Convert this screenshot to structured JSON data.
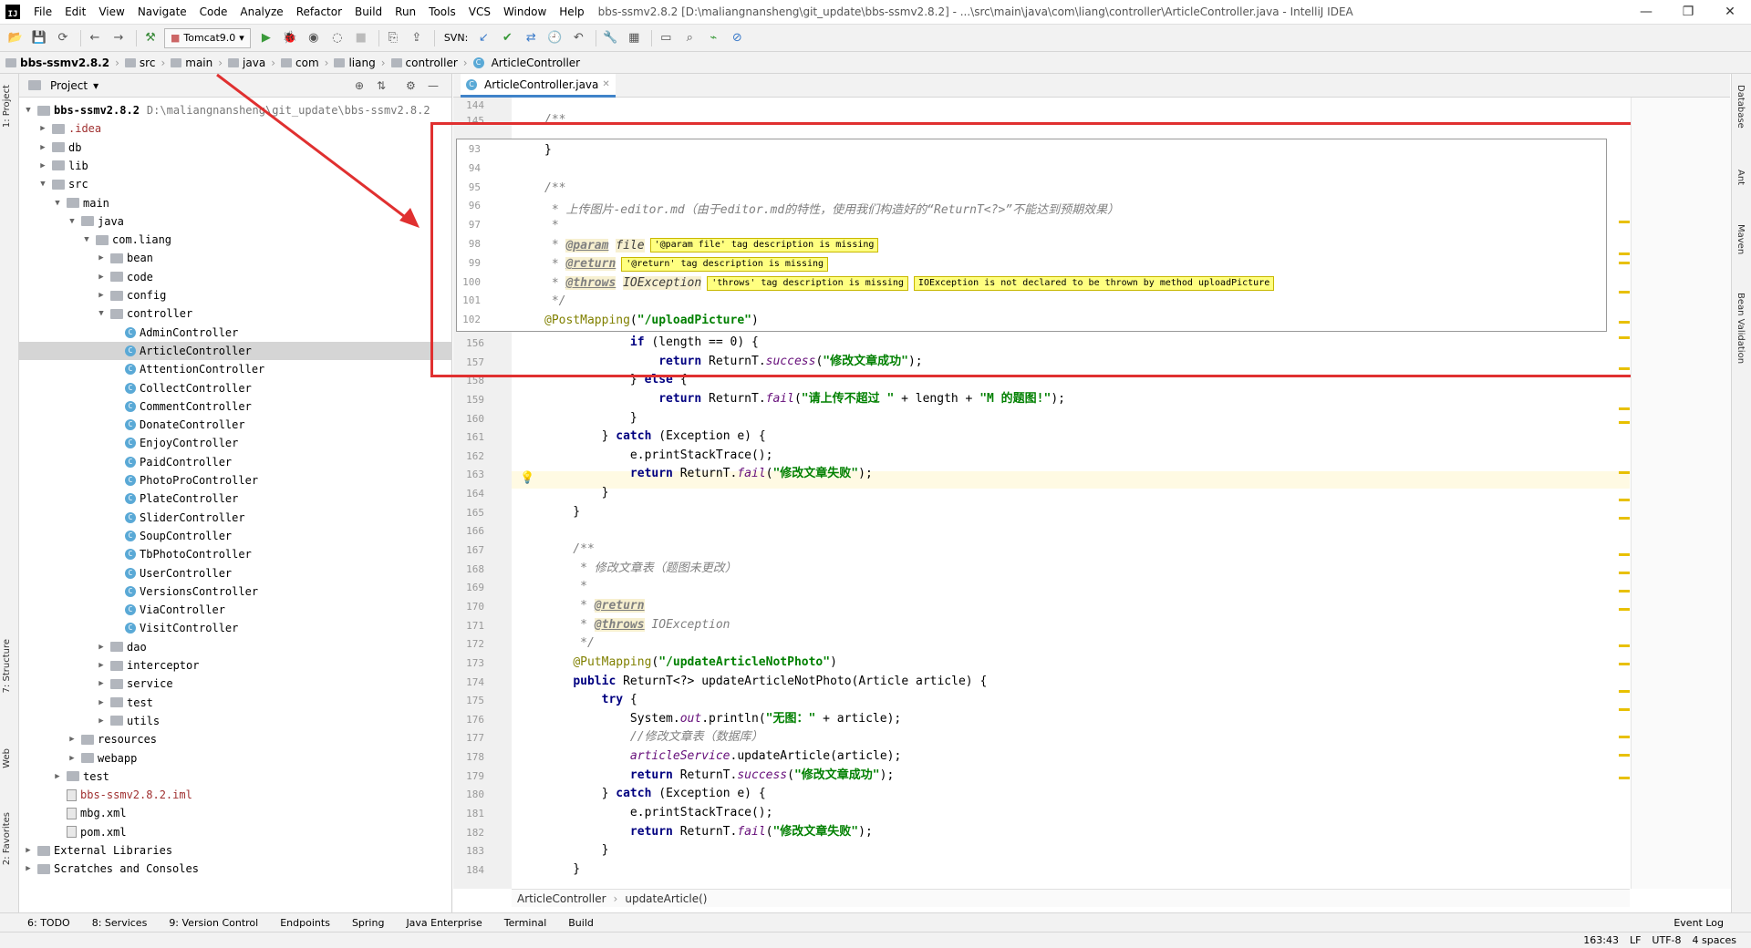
{
  "title_bar": {
    "menus": [
      "File",
      "Edit",
      "View",
      "Navigate",
      "Code",
      "Analyze",
      "Refactor",
      "Build",
      "Run",
      "Tools",
      "VCS",
      "Window",
      "Help"
    ],
    "window_title": "bbs-ssmv2.8.2 [D:\\maliangnansheng\\git_update\\bbs-ssmv2.8.2] - ...\\src\\main\\java\\com\\liang\\controller\\ArticleController.java - IntelliJ IDEA"
  },
  "toolbar": {
    "run_config": "Tomcat9.0",
    "svn_label": "SVN:"
  },
  "breadcrumb": [
    "bbs-ssmv2.8.2",
    "src",
    "main",
    "java",
    "com",
    "liang",
    "controller",
    "ArticleController"
  ],
  "project_panel": {
    "title": "Project",
    "tree": [
      {
        "label": "bbs-ssmv2.8.2",
        "path": "D:\\maliangnansheng\\git_update\\bbs-ssmv2.8.2",
        "depth": 0,
        "type": "folder",
        "open": true
      },
      {
        "label": ".idea",
        "depth": 1,
        "type": "folder",
        "open": false
      },
      {
        "label": "db",
        "depth": 1,
        "type": "folder",
        "open": false
      },
      {
        "label": "lib",
        "depth": 1,
        "type": "folder",
        "open": false
      },
      {
        "label": "src",
        "depth": 1,
        "type": "folder",
        "open": true
      },
      {
        "label": "main",
        "depth": 2,
        "type": "folder",
        "open": true
      },
      {
        "label": "java",
        "depth": 3,
        "type": "folder",
        "open": true
      },
      {
        "label": "com.liang",
        "depth": 4,
        "type": "folder",
        "open": true
      },
      {
        "label": "bean",
        "depth": 5,
        "type": "folder",
        "open": false
      },
      {
        "label": "code",
        "depth": 5,
        "type": "folder",
        "open": false
      },
      {
        "label": "config",
        "depth": 5,
        "type": "folder",
        "open": false
      },
      {
        "label": "controller",
        "depth": 5,
        "type": "folder",
        "open": true
      },
      {
        "label": "AdminController",
        "depth": 6,
        "type": "class"
      },
      {
        "label": "ArticleController",
        "depth": 6,
        "type": "class",
        "selected": true
      },
      {
        "label": "AttentionController",
        "depth": 6,
        "type": "class"
      },
      {
        "label": "CollectController",
        "depth": 6,
        "type": "class"
      },
      {
        "label": "CommentController",
        "depth": 6,
        "type": "class"
      },
      {
        "label": "DonateController",
        "depth": 6,
        "type": "class"
      },
      {
        "label": "EnjoyController",
        "depth": 6,
        "type": "class"
      },
      {
        "label": "PaidController",
        "depth": 6,
        "type": "class"
      },
      {
        "label": "PhotoProController",
        "depth": 6,
        "type": "class"
      },
      {
        "label": "PlateController",
        "depth": 6,
        "type": "class"
      },
      {
        "label": "SliderController",
        "depth": 6,
        "type": "class"
      },
      {
        "label": "SoupController",
        "depth": 6,
        "type": "class"
      },
      {
        "label": "TbPhotoController",
        "depth": 6,
        "type": "class"
      },
      {
        "label": "UserController",
        "depth": 6,
        "type": "class"
      },
      {
        "label": "VersionsController",
        "depth": 6,
        "type": "class"
      },
      {
        "label": "ViaController",
        "depth": 6,
        "type": "class"
      },
      {
        "label": "VisitController",
        "depth": 6,
        "type": "class"
      },
      {
        "label": "dao",
        "depth": 5,
        "type": "folder",
        "open": false
      },
      {
        "label": "interceptor",
        "depth": 5,
        "type": "folder",
        "open": false
      },
      {
        "label": "service",
        "depth": 5,
        "type": "folder",
        "open": false
      },
      {
        "label": "test",
        "depth": 5,
        "type": "folder",
        "open": false
      },
      {
        "label": "utils",
        "depth": 5,
        "type": "folder",
        "open": false
      },
      {
        "label": "resources",
        "depth": 3,
        "type": "folder",
        "open": false
      },
      {
        "label": "webapp",
        "depth": 3,
        "type": "folder",
        "open": false
      },
      {
        "label": "test",
        "depth": 2,
        "type": "folder",
        "open": false
      },
      {
        "label": "bbs-ssmv2.8.2.iml",
        "depth": 2,
        "type": "file"
      },
      {
        "label": "mbg.xml",
        "depth": 2,
        "type": "file"
      },
      {
        "label": "pom.xml",
        "depth": 2,
        "type": "file"
      },
      {
        "label": "External Libraries",
        "depth": 0,
        "type": "folder",
        "open": false
      },
      {
        "label": "Scratches and Consoles",
        "depth": 0,
        "type": "folder",
        "open": false
      }
    ]
  },
  "editor": {
    "tab": "ArticleController.java",
    "popup_lines": [
      {
        "n": "93",
        "html": "}"
      },
      {
        "n": "94",
        "html": ""
      },
      {
        "n": "95",
        "html": "/**"
      },
      {
        "n": "96",
        "html": " * 上传图片-editor.md（由于editor.md的特性，使用我们构造好的“ReturnT<?>”不能达到预期效果）"
      },
      {
        "n": "97",
        "html": " *"
      },
      {
        "n": "98",
        "tag": "@param",
        "arg": "file",
        "warns": [
          "'@param file' tag description is missing"
        ]
      },
      {
        "n": "99",
        "tag": "@return",
        "arg": "",
        "warns": [
          "'@return' tag description is missing"
        ]
      },
      {
        "n": "100",
        "tag": "@throws",
        "arg": "IOException",
        "warns": [
          "'throws' tag description is missing",
          "IOException is not declared to be thrown by method uploadPicture"
        ]
      },
      {
        "n": "101",
        "html": " */"
      },
      {
        "n": "102",
        "html": "@PostMapping(\"/uploadPicture\")"
      }
    ],
    "lines": [
      {
        "n": "144",
        "t": ""
      },
      {
        "n": "145",
        "t": "/**"
      },
      {
        "n": "156",
        "t": "            if (length == 0) {"
      },
      {
        "n": "157",
        "t": "                return ReturnT.success(\"修改文章成功\");"
      },
      {
        "n": "158",
        "t": "            } else {"
      },
      {
        "n": "159",
        "t": "                return ReturnT.fail(\"请上传不超过 \" + length + \"M 的题图!\");"
      },
      {
        "n": "160",
        "t": "            }"
      },
      {
        "n": "161",
        "t": "        } catch (Exception e) {"
      },
      {
        "n": "162",
        "t": "            e.printStackTrace();"
      },
      {
        "n": "163",
        "t": "            return ReturnT.fail(\"修改文章失败\");"
      },
      {
        "n": "164",
        "t": "        }"
      },
      {
        "n": "165",
        "t": "    }"
      },
      {
        "n": "166",
        "t": ""
      },
      {
        "n": "167",
        "t": "    /**"
      },
      {
        "n": "168",
        "t": "     * 修改文章表（题图未更改）"
      },
      {
        "n": "169",
        "t": "     *"
      },
      {
        "n": "170",
        "t": "     * @return"
      },
      {
        "n": "171",
        "t": "     * @throws IOException"
      },
      {
        "n": "172",
        "t": "     */"
      },
      {
        "n": "173",
        "t": "    @PutMapping(\"/updateArticleNotPhoto\")"
      },
      {
        "n": "174",
        "t": "    public ReturnT<?> updateArticleNotPhoto(Article article) {"
      },
      {
        "n": "175",
        "t": "        try {"
      },
      {
        "n": "176",
        "t": "            System.out.println(\"无图：\" + article);"
      },
      {
        "n": "177",
        "t": "            //修改文章表（数据库）"
      },
      {
        "n": "178",
        "t": "            articleService.updateArticle(article);"
      },
      {
        "n": "179",
        "t": "            return ReturnT.success(\"修改文章成功\");"
      },
      {
        "n": "180",
        "t": "        } catch (Exception e) {"
      },
      {
        "n": "181",
        "t": "            e.printStackTrace();"
      },
      {
        "n": "182",
        "t": "            return ReturnT.fail(\"修改文章失败\");"
      },
      {
        "n": "183",
        "t": "        }"
      },
      {
        "n": "184",
        "t": "    }"
      }
    ],
    "code_breadcrumb": [
      "ArticleController",
      "updateArticle()"
    ]
  },
  "left_strip": [
    "1: Project",
    "7: Structure",
    "Web",
    "2: Favorites"
  ],
  "right_strip": [
    "Database",
    "Ant",
    "Maven",
    "Bean Validation"
  ],
  "bottom_tools": [
    "6: TODO",
    "8: Services",
    "9: Version Control",
    "Endpoints",
    "Spring",
    "Java Enterprise",
    "Terminal",
    "Build"
  ],
  "event_log": "Event Log",
  "status": {
    "position": "163:43",
    "line_sep": "LF",
    "encoding": "UTF-8",
    "indent": "4 spaces"
  }
}
